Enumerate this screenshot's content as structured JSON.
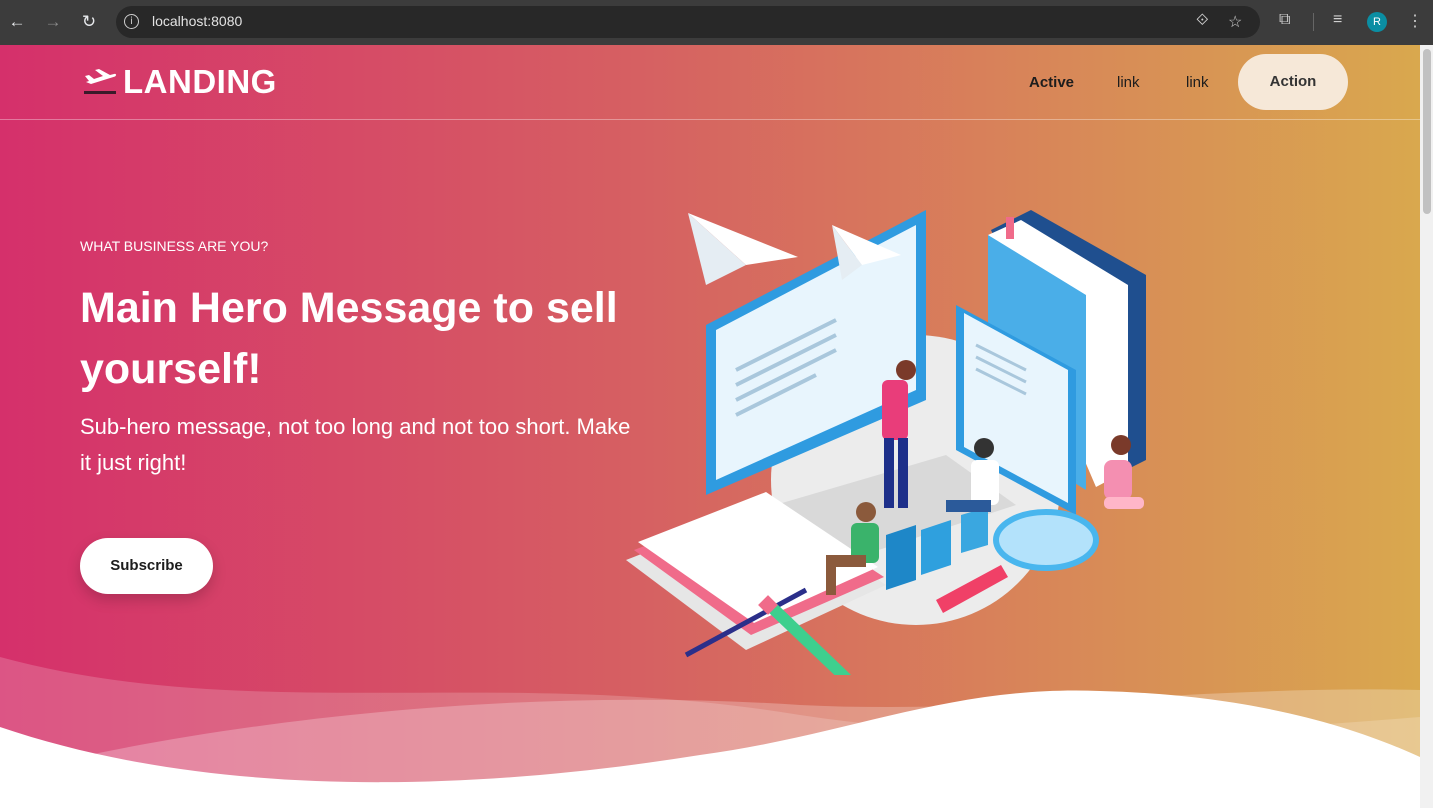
{
  "browser": {
    "url": "localhost:8080",
    "avatar_letter": "R"
  },
  "navbar": {
    "logo_text": "LANDING",
    "links": [
      "Active",
      "link",
      "link"
    ],
    "action_label": "Action"
  },
  "hero": {
    "eyebrow": "WHAT BUSINESS ARE YOU?",
    "title": "Main Hero Message to sell yourself!",
    "subtitle": "Sub-hero message, not too long and not too short. Make it just right!",
    "cta_label": "Subscribe"
  },
  "colors": {
    "gradient_start": "#d5306b",
    "gradient_end": "#d9a84e",
    "action_bg": "#f6e8d8"
  }
}
